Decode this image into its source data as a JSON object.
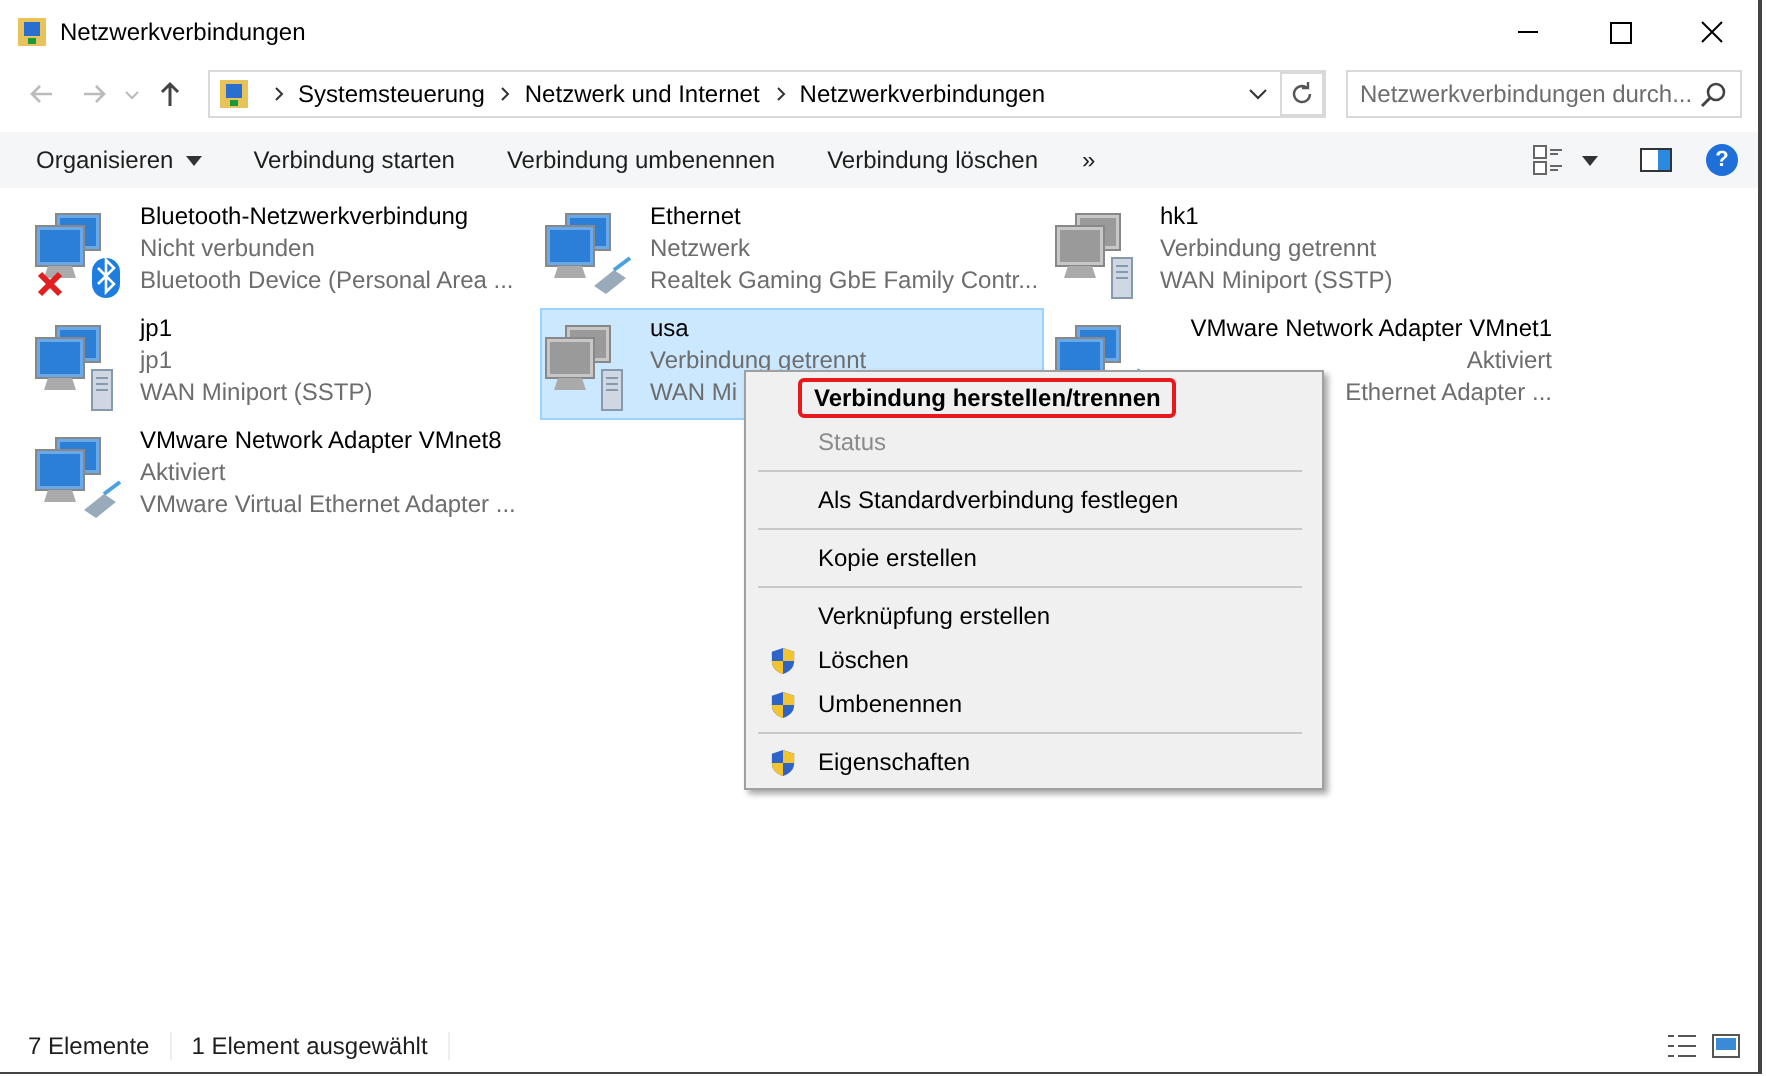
{
  "window": {
    "title": "Netzwerkverbindungen"
  },
  "address": {
    "segments": [
      "Systemsteuerung",
      "Netzwerk und Internet",
      "Netzwerkverbindungen"
    ]
  },
  "search": {
    "placeholder": "Netzwerkverbindungen durch..."
  },
  "toolbar": {
    "buttons": [
      {
        "label": "Organisieren",
        "dropdown": true
      },
      {
        "label": "Verbindung starten",
        "dropdown": false
      },
      {
        "label": "Verbindung umbenennen",
        "dropdown": false
      },
      {
        "label": "Verbindung löschen",
        "dropdown": false
      }
    ],
    "more": "»",
    "help": "?"
  },
  "connections": [
    {
      "name": "Bluetooth-Netzwerkverbindung",
      "status": "Nicht verbunden",
      "device": "Bluetooth Device (Personal Area ...",
      "kind": "bluetooth",
      "connected": true,
      "crossed": true,
      "selected": false,
      "covered": false
    },
    {
      "name": "Ethernet",
      "status": "Netzwerk",
      "device": "Realtek Gaming GbE Family Contr...",
      "kind": "ethernet",
      "connected": true,
      "crossed": false,
      "selected": false,
      "covered": false
    },
    {
      "name": "hk1",
      "status": "Verbindung getrennt",
      "device": "WAN Miniport (SSTP)",
      "kind": "wan",
      "connected": false,
      "crossed": false,
      "selected": false,
      "covered": false
    },
    {
      "name": "jp1",
      "status": "jp1",
      "device": "WAN Miniport (SSTP)",
      "kind": "wan",
      "connected": true,
      "crossed": false,
      "selected": false,
      "covered": false
    },
    {
      "name": "usa",
      "status": "Verbindung getrennt",
      "device": "WAN Mi",
      "kind": "wan",
      "connected": false,
      "crossed": false,
      "selected": true,
      "covered": false
    },
    {
      "name": "VMware Network Adapter VMnet1",
      "status": "Aktiviert",
      "device": "Ethernet Adapter ...",
      "kind": "ethernet",
      "connected": true,
      "crossed": false,
      "selected": false,
      "covered": true
    },
    {
      "name": "VMware Network Adapter VMnet8",
      "status": "Aktiviert",
      "device": "VMware Virtual Ethernet Adapter ...",
      "kind": "ethernet",
      "connected": true,
      "crossed": false,
      "selected": false,
      "covered": false
    }
  ],
  "context_menu": {
    "groups": [
      [
        {
          "label": "Verbindung herstellen/trennen",
          "default": true,
          "disabled": false,
          "shield": false,
          "highlighted": true
        },
        {
          "label": "Status",
          "default": false,
          "disabled": true,
          "shield": false,
          "highlighted": false
        }
      ],
      [
        {
          "label": "Als Standardverbindung festlegen",
          "default": false,
          "disabled": false,
          "shield": false,
          "highlighted": false
        }
      ],
      [
        {
          "label": "Kopie erstellen",
          "default": false,
          "disabled": false,
          "shield": false,
          "highlighted": false
        }
      ],
      [
        {
          "label": "Verknüpfung erstellen",
          "default": false,
          "disabled": false,
          "shield": false,
          "highlighted": false
        },
        {
          "label": "Löschen",
          "default": false,
          "disabled": false,
          "shield": true,
          "highlighted": false
        },
        {
          "label": "Umbenennen",
          "default": false,
          "disabled": false,
          "shield": true,
          "highlighted": false
        }
      ],
      [
        {
          "label": "Eigenschaften",
          "default": false,
          "disabled": false,
          "shield": true,
          "highlighted": false
        }
      ]
    ]
  },
  "status_bar": {
    "count": "7 Elemente",
    "selection": "1 Element ausgewählt"
  }
}
